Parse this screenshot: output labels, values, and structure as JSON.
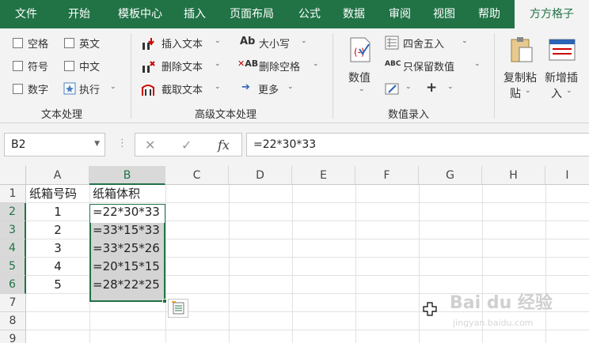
{
  "tabs": [
    {
      "label": "文件",
      "active": false
    },
    {
      "label": "开始",
      "active": false
    },
    {
      "label": "模板中心",
      "active": false
    },
    {
      "label": "插入",
      "active": false
    },
    {
      "label": "页面布局",
      "active": false
    },
    {
      "label": "公式",
      "active": false
    },
    {
      "label": "数据",
      "active": false
    },
    {
      "label": "审阅",
      "active": false
    },
    {
      "label": "视图",
      "active": false
    },
    {
      "label": "帮助",
      "active": false
    },
    {
      "label": "方方格子",
      "active": true
    }
  ],
  "ribbon": {
    "text_group": {
      "label": "文本处理",
      "checkboxes": [
        "空格",
        "英文",
        "符号",
        "中文",
        "数字"
      ],
      "execute_label": "执行"
    },
    "advanced_group": {
      "label": "高级文本处理",
      "insert_text": "插入文本",
      "delete_text": "删除文本",
      "extract_text": "截取文本",
      "case_label": "大小写",
      "delete_space": "删除空格",
      "more_label": "更多"
    },
    "numeric_group": {
      "label": "数值录入",
      "numeric_label": "数值",
      "round_label": "四舍五入",
      "keep_numeric": "只保留数值",
      "plus_label": "+"
    },
    "copy_paste": "复制粘贴",
    "add_insert": "新增插入",
    "copy_paste_lines": [
      "复制粘",
      "贴"
    ],
    "add_insert_lines": [
      "新增插",
      "入"
    ],
    "cut_label": "插"
  },
  "formula_bar": {
    "name_box": "B2",
    "cancel": "✕",
    "enter": "✓",
    "fx": "fx",
    "formula": "=22*30*33"
  },
  "sheet": {
    "columns": [
      "A",
      "B",
      "C",
      "D",
      "E",
      "F",
      "G",
      "H",
      "I"
    ],
    "rows": [
      "1",
      "2",
      "3",
      "4",
      "5",
      "6",
      "7",
      "8",
      "9"
    ],
    "header_a": "纸箱号码",
    "header_b": "纸箱体积",
    "data": [
      {
        "a": "1",
        "b": "=22*30*33"
      },
      {
        "a": "2",
        "b": "=33*15*33"
      },
      {
        "a": "3",
        "b": "=33*25*26"
      },
      {
        "a": "4",
        "b": "=20*15*15"
      },
      {
        "a": "5",
        "b": "=28*22*25"
      }
    ]
  },
  "watermark": {
    "main": "Bai du 经验",
    "sub": "jingyan.baidu.com"
  },
  "colors": {
    "accent": "#217346",
    "ribbon_bg": "#f3f3f3",
    "selection": "#d4d4d4"
  }
}
